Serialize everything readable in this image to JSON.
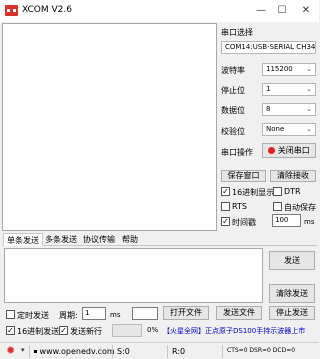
{
  "title": "XCOM V2.6",
  "port_panel": {
    "heading": "串口选择",
    "port_value": "COM14:USB-SERIAL CH34",
    "baud_label": "波特率",
    "baud_value": "115200",
    "stopbits_label": "停止位",
    "stopbits_value": "1",
    "databits_label": "数据位",
    "databits_value": "8",
    "parity_label": "校验位",
    "parity_value": "None",
    "operation_label": "串口操作",
    "close_port": "关闭串口"
  },
  "recv_options": {
    "save_window": "保存窗口",
    "clear_receive": "清除接收",
    "hex_display": "16进制显示",
    "dtr": "DTR",
    "rts": "RTS",
    "auto_save": "自动保存",
    "timestamp": "时间戳",
    "timestamp_value": "100",
    "timestamp_unit": "ms"
  },
  "tabs": [
    "单条发送",
    "多条发送",
    "协议传输",
    "帮助"
  ],
  "send": {
    "send_button": "发送",
    "clear_send": "清除发送",
    "timed_send": "定时发送",
    "period_label": "周期:",
    "period_value": "1",
    "period_unit": "ms",
    "open_file": "打开文件",
    "send_file": "发送文件",
    "stop_send": "停止发送",
    "hex_send": "16进制发送",
    "newline": "发送新行",
    "progress": "0%",
    "ad_text": "【火星全网】正点原子DS100手持示波器上市"
  },
  "status": {
    "url": "www.openedv.com",
    "sent": "S:0",
    "received": "R:0",
    "cts": "CTS=0 DSR=0 DCD=0"
  },
  "colors": {
    "accent": "#d9342b",
    "link": "#0000cc"
  }
}
